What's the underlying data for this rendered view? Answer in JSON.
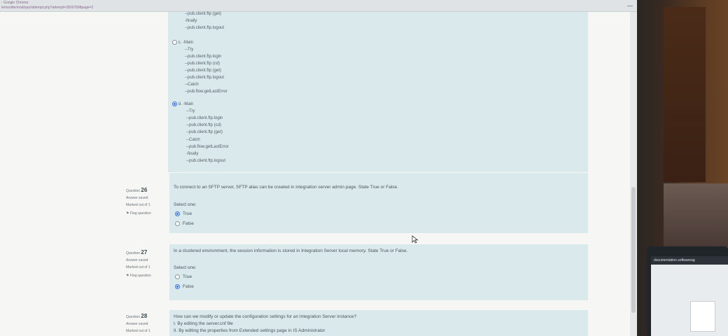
{
  "browser": {
    "title": "- Google Chrome",
    "url": "lemoodle/mod/quiz/attempt.php?attempt=28267698page=2"
  },
  "prev_answer": {
    "top_lines": [
      "--pub.client.ftp (get)",
      "-finally",
      "--pub.client.ftp.logout"
    ],
    "option_c": {
      "label": "c. -Main",
      "lines": [
        "--Try",
        "--pub.client.ftp.login",
        "--pub.client.ftp (cd)",
        "--pub.client.ftp (get)",
        "--pub.client.ftp.logout",
        "--Catch",
        "--pub.flow.getLastError"
      ]
    },
    "option_d": {
      "label": "d. -Main",
      "lines": [
        "--Try",
        "--pub.client.ftp.login",
        "--pub.client.ftp (cd)",
        "--pub.client.ftp (get)",
        "--Catch",
        "--pub.flow.getLastError",
        "-finally",
        "--pub.client.ftp.logout"
      ]
    }
  },
  "questions": [
    {
      "number_prefix": "Question",
      "number": "26",
      "status": "Answer saved",
      "marks": "Marked out of 1",
      "flag": "Flag question",
      "text": "To connect to an SFTP server, SFTP alias can be created in integration server admin page. State True or False.",
      "prompt": "Select one:",
      "options": [
        "True",
        "False"
      ],
      "selected": 0
    },
    {
      "number_prefix": "Question",
      "number": "27",
      "status": "Answer saved",
      "marks": "Marked out of 1",
      "flag": "Flag question",
      "text": "In a clustered environment, the session information is stored in Integration Server local memory. State True or False.",
      "prompt": "Select one:",
      "options": [
        "True",
        "False"
      ],
      "selected": 1
    },
    {
      "number_prefix": "Question",
      "number": "28",
      "status": "Answer saved",
      "marks": "Marked out of 1",
      "text": "How can we modify or update the configuration settings for an Integration Server instance?",
      "lines": [
        "I. By editing the server.cnf file",
        "II. By editing the properties from Extended settings page in IS Administrator"
      ]
    }
  ],
  "tablet": {
    "bar_text": "documentation.softwareag"
  },
  "colors": {
    "question_bg": "#d9e9ec",
    "accent": "#3a6fd8"
  }
}
